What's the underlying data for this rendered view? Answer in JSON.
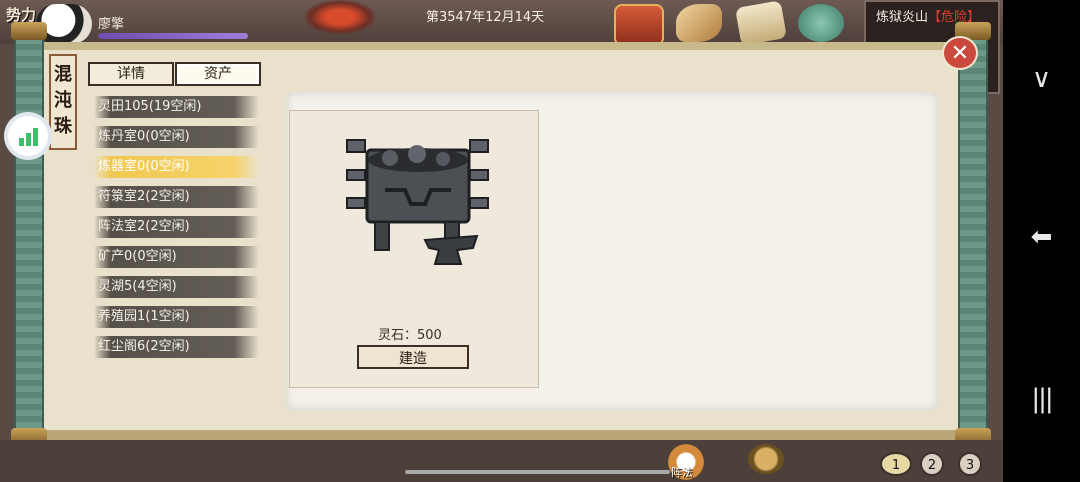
{
  "header": {
    "faction_label": "势力",
    "player_name": "廖擎",
    "date": "第3547年12月14天",
    "location_name": "炼狱炎山",
    "location_status": "【危险】"
  },
  "title_tag": {
    "text": "混\n沌\n珠"
  },
  "tabs": [
    {
      "label": "详情"
    },
    {
      "label": "资产"
    }
  ],
  "rooms": [
    {
      "label": "灵田105(19空闲)"
    },
    {
      "label": "炼丹室0(0空闲)"
    },
    {
      "label": "炼器室0(0空闲)",
      "selected": true
    },
    {
      "label": "符箓室2(2空闲)"
    },
    {
      "label": "阵法室2(2空闲)"
    },
    {
      "label": "矿产0(0空闲)"
    },
    {
      "label": "灵湖5(4空闲)"
    },
    {
      "label": "养殖园1(1空闲)"
    },
    {
      "label": "红尘阁6(2空闲)"
    }
  ],
  "build_panel": {
    "cost_text": "灵石：500",
    "build_label": "建造"
  },
  "bottom_bar": {
    "formation_label": "阵法",
    "pages": [
      "1",
      "2",
      "3"
    ]
  },
  "icons": {
    "close": "close-icon",
    "signal": "signal-bars-icon",
    "chest": "treasure-chest-icon",
    "horn": "horn-icon",
    "scroll": "scroll-icon",
    "beast": "beast-icon",
    "refresh": "refresh-icon"
  },
  "system_nav": {
    "chevron": "∨",
    "back": "⬅",
    "menu": "|||"
  }
}
